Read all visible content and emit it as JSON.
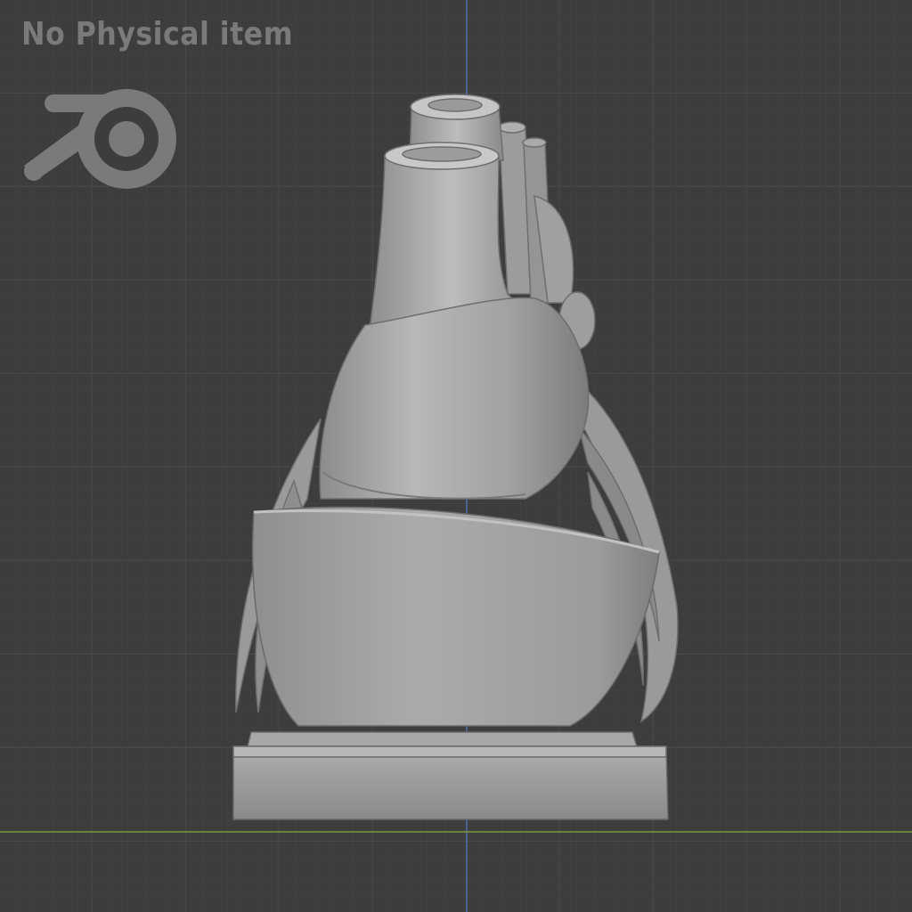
{
  "viewport": {
    "watermark_text": "No Physical item",
    "logo_icon": "blender-logo-icon",
    "model": "heart-anatomy-model-on-pedestal",
    "colors": {
      "background": "#3d3d3d",
      "grid_minor": "#444444",
      "grid_major": "#4a4a4a",
      "axis_x": "#7d9a3a",
      "axis_z": "#4c6fa8",
      "model_base": "#9e9e9e",
      "model_light": "#bdbdbd",
      "model_shadow": "#7a7a7a",
      "watermark": "#7a7a7a"
    }
  }
}
